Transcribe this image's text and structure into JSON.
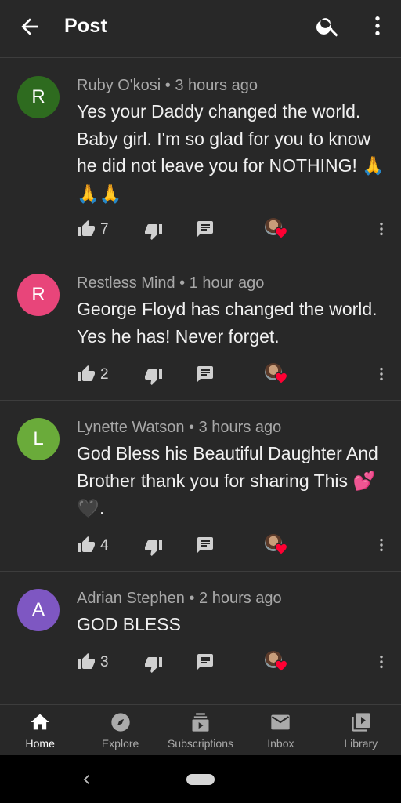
{
  "header": {
    "title": "Post",
    "back_icon": "arrow-back-icon",
    "search_icon": "search-icon",
    "more_icon": "more-vert-icon"
  },
  "comments": [
    {
      "initial": "R",
      "avatar_color": "#2e6b1f",
      "author": "Ruby O'kosi",
      "time": "3 hours ago",
      "text": "Yes your Daddy changed the world. Baby girl. I'm so glad for you to know he did not leave you for NOTHING! ",
      "emoji": "🙏🙏🙏",
      "likes": "7"
    },
    {
      "initial": "R",
      "avatar_color": "#e8457a",
      "author": "Restless Mind",
      "time": "1 hour ago",
      "text": "George Floyd has changed the world.  Yes he has!  Never forget.",
      "emoji": "",
      "likes": "2"
    },
    {
      "initial": "L",
      "avatar_color": "#6aab3a",
      "author": "Lynette Watson",
      "time": "3 hours ago",
      "text": "God Bless his Beautiful Daughter And Brother thank you for sharing This ",
      "emoji": "💕🖤.",
      "likes": "4"
    },
    {
      "initial": "A",
      "avatar_color": "#7e57c2",
      "author": "Adrian Stephen",
      "time": "2 hours ago",
      "text": "GOD BLESS",
      "emoji": "",
      "likes": "3"
    }
  ],
  "separator": " • ",
  "bottom_nav": [
    {
      "label": "Home",
      "icon": "home-icon",
      "active": true
    },
    {
      "label": "Explore",
      "icon": "compass-icon",
      "active": false
    },
    {
      "label": "Subscriptions",
      "icon": "subscriptions-icon",
      "active": false
    },
    {
      "label": "Inbox",
      "icon": "mail-icon",
      "active": false
    },
    {
      "label": "Library",
      "icon": "library-icon",
      "active": false
    }
  ],
  "colors": {
    "background": "#282828",
    "heart": "#ff0033",
    "meta_text": "#a8a8a8"
  }
}
